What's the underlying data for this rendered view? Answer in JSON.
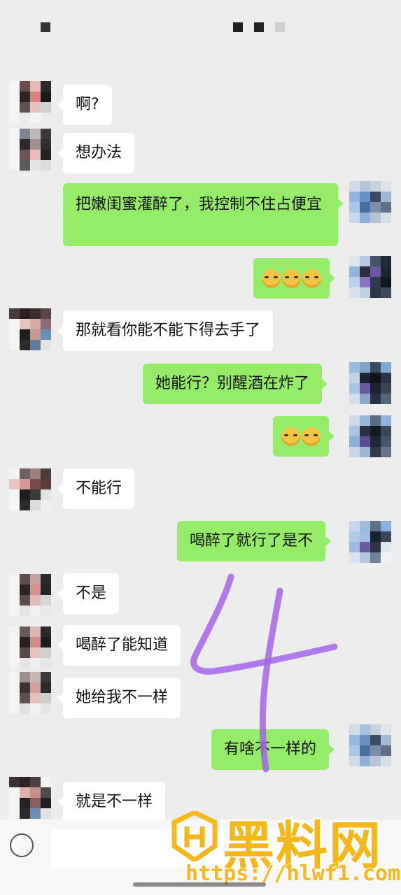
{
  "colors": {
    "background": "#ededed",
    "incoming_bubble": "#ffffff",
    "outgoing_bubble": "#95ec69",
    "annotation": "#a463e8",
    "watermark": "#f6b71a"
  },
  "messages": [
    {
      "side": "left",
      "text": "啊?"
    },
    {
      "side": "left",
      "text": "想办法"
    },
    {
      "side": "right",
      "text": "把嫩闺蜜灌醉了，我控制不住占便宜"
    },
    {
      "side": "right",
      "emoji": "doge-emoji",
      "count": 3
    },
    {
      "side": "left",
      "text": "那就看你能不能下得去手了"
    },
    {
      "side": "right",
      "text": "她能行？别醒酒在炸了"
    },
    {
      "side": "right",
      "emoji": "doge-emoji",
      "count": 2
    },
    {
      "side": "left",
      "text": "不能行"
    },
    {
      "side": "right",
      "text": "喝醉了就行了是不"
    },
    {
      "side": "left",
      "text": "不是"
    },
    {
      "side": "left",
      "text": "喝醉了能知道"
    },
    {
      "side": "left",
      "text": "她给我不一样"
    },
    {
      "side": "right",
      "text": "有啥不一样的"
    },
    {
      "side": "left",
      "text": "就是不一样"
    }
  ],
  "annotation": {
    "label": "4"
  },
  "watermark": {
    "brand": "黑料网",
    "url": "https://hlwf1.com"
  }
}
